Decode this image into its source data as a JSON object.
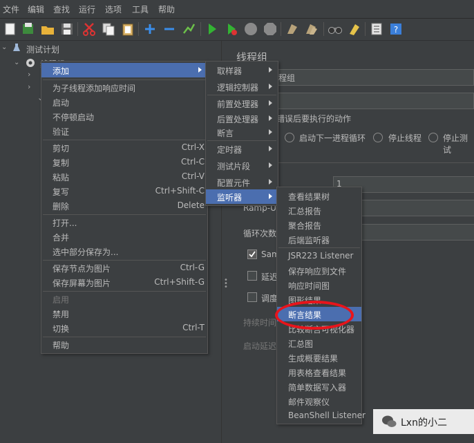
{
  "menubar": {
    "items": [
      "文件",
      "编辑",
      "查找",
      "运行",
      "选项",
      "工具",
      "帮助"
    ]
  },
  "toolbar": {
    "icons": [
      "new-icon",
      "templates-icon",
      "open-icon",
      "save-icon",
      "cut-icon",
      "copy-icon",
      "paste-icon",
      "add-icon",
      "remove-icon",
      "toggle-icon",
      "start-icon",
      "start-no-pause-icon",
      "stop-icon",
      "shutdown-icon",
      "clear-icon",
      "clear-all-icon",
      "search-icon",
      "reset-search-icon",
      "function-helper-icon",
      "help-icon"
    ]
  },
  "tree": {
    "root": "测试计划",
    "thread_group": "线程组"
  },
  "right": {
    "title": "线程组",
    "name_value": "程组",
    "error_action_label": "错误后要执行的动作",
    "radio_next_loop": "启动下一进程循环",
    "radio_stop_thread": "停止线程",
    "radio_stop_test": "停止测试",
    "threads_value": "1",
    "rampup_label": "Ramp-Up",
    "loop_label": "循环次数",
    "same_user_label": "Sam",
    "delay_label": "延迟",
    "scheduler_label": "调度",
    "duration_label": "持续时间",
    "startup_delay_label": "启动延迟"
  },
  "context_menu": {
    "items": [
      {
        "label": "添加",
        "shortcut": "",
        "submenu": true,
        "selected": true
      },
      {
        "label": "为子线程添加响应时间",
        "shortcut": ""
      },
      {
        "label": "启动",
        "shortcut": ""
      },
      {
        "label": "不停顿启动",
        "shortcut": ""
      },
      {
        "label": "验证",
        "shortcut": ""
      },
      {
        "label": "剪切",
        "shortcut": "Ctrl-X"
      },
      {
        "label": "复制",
        "shortcut": "Ctrl-C"
      },
      {
        "label": "粘贴",
        "shortcut": "Ctrl-V"
      },
      {
        "label": "复写",
        "shortcut": "Ctrl+Shift-C"
      },
      {
        "label": "删除",
        "shortcut": "Delete"
      },
      {
        "label": "打开...",
        "shortcut": ""
      },
      {
        "label": "合并",
        "shortcut": ""
      },
      {
        "label": "选中部分保存为...",
        "shortcut": ""
      },
      {
        "label": "保存节点为图片",
        "shortcut": "Ctrl-G"
      },
      {
        "label": "保存屏幕为图片",
        "shortcut": "Ctrl+Shift-G"
      },
      {
        "label": "启用",
        "shortcut": "",
        "disabled": true
      },
      {
        "label": "禁用",
        "shortcut": ""
      },
      {
        "label": "切换",
        "shortcut": "Ctrl-T"
      },
      {
        "label": "帮助",
        "shortcut": ""
      }
    ]
  },
  "add_submenu": {
    "items": [
      "取样器",
      "逻辑控制器",
      "前置处理器",
      "后置处理器",
      "断言",
      "定时器",
      "测试片段",
      "配置元件",
      "监听器"
    ],
    "selected": "监听器"
  },
  "listener_submenu": {
    "items": [
      "查看结果树",
      "汇总报告",
      "聚合报告",
      "后端监听器",
      "JSR223 Listener",
      "保存响应到文件",
      "响应时间图",
      "图形结果",
      "断言结果",
      "比较断言可视化器",
      "汇总图",
      "生成概要结果",
      "用表格查看结果",
      "简单数据写入器",
      "邮件观察仪",
      "BeanShell Listener"
    ],
    "selected": "断言结果"
  },
  "watermark": {
    "text": "Lxn的小二"
  },
  "colors": {
    "background": "#3c3f41",
    "selection": "#4b6eaf",
    "highlight_circle": "#e8141b",
    "text": "#bbbbbb"
  }
}
